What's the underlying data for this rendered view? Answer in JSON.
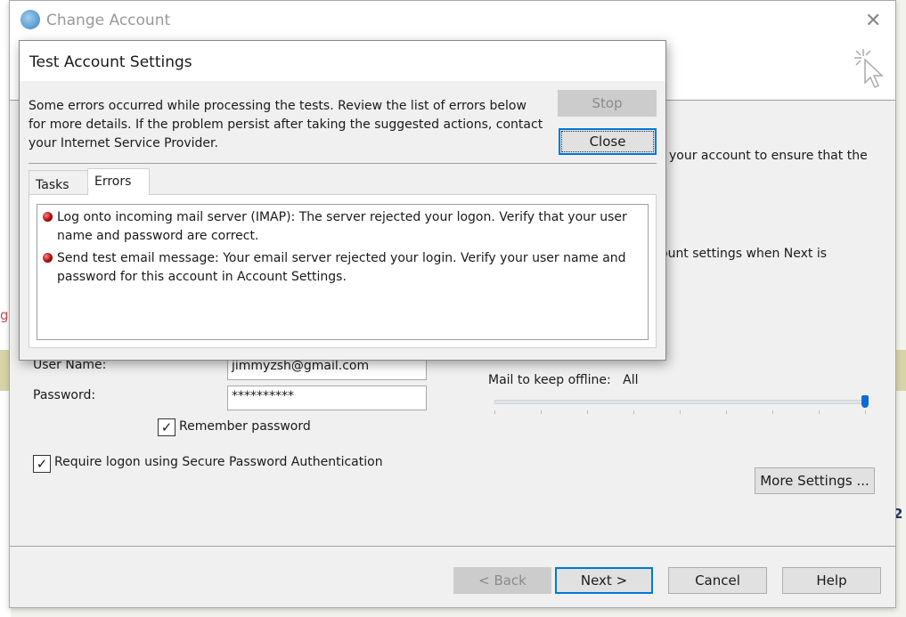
{
  "background": {
    "fragment_text": "g,",
    "fragment_number": "2"
  },
  "window": {
    "title": "Change Account",
    "close_icon": "close-icon",
    "cursor_icon": "click-cursor-icon",
    "desc1": "your account to ensure that the",
    "desc2": "ount settings when Next is",
    "user_name_label": "User Name:",
    "user_name_value": "jimmyzsh@gmail.com",
    "password_label": "Password:",
    "password_value": "**********",
    "remember_password": {
      "label": "Remember password",
      "checked": true
    },
    "require_spa": {
      "label": "Require logon using Secure Password Authentication",
      "checked": true
    },
    "mail_offline_label": "Mail to keep offline:",
    "mail_offline_value": "All",
    "mail_offline_slider": {
      "position": 8,
      "of": 8
    },
    "more_settings": "More Settings ...",
    "buttons": {
      "back": "< Back",
      "next": "Next >",
      "cancel": "Cancel",
      "help": "Help"
    }
  },
  "dialog": {
    "title": "Test Account Settings",
    "message": "Some errors occurred while processing the tests. Review the list of errors below for more details. If the problem persist after taking the suggested actions, contact your Internet Service Provider.",
    "stop": "Stop",
    "close": "Close",
    "tabs": [
      {
        "label": "Tasks",
        "active": false
      },
      {
        "label": "Errors",
        "active": true
      }
    ],
    "errors": [
      "Log onto incoming mail server (IMAP): The server rejected your logon. Verify that your user name and password are correct.",
      "Send test email message: Your email server rejected your login. Verify your user name and password for this account in Account Settings."
    ],
    "error_color": "#a00000",
    "accent": "#0078d7"
  }
}
